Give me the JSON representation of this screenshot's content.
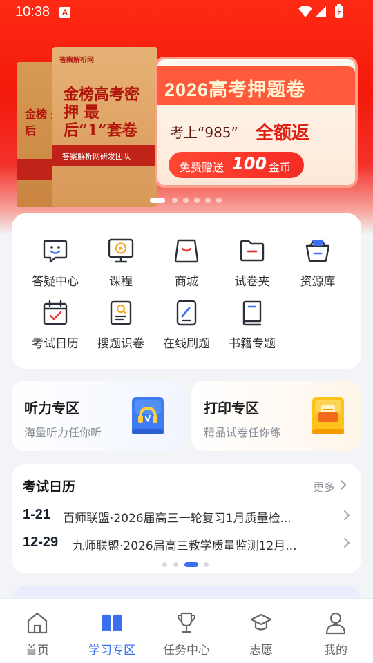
{
  "status_bar": {
    "time": "10:38",
    "notification_badge": "A"
  },
  "banner": {
    "book_label": "答案解析网",
    "book_title": "金榜高考密押 最后“1”套卷",
    "book_back_title": "金榜 最后",
    "book_stripe": "答案解析网研发团队",
    "title": "2026高考押题卷",
    "subtitle": "考上“985”",
    "subtitle_strong": "全额返",
    "pill_prefix": "免费赠送",
    "pill_amount": "100",
    "pill_suffix": "金币",
    "dot_count": 6,
    "active_dot": 0
  },
  "grid": {
    "items": [
      {
        "label": "答疑中心",
        "icon": "chat-bubble-icon"
      },
      {
        "label": "课程",
        "icon": "monitor-play-icon"
      },
      {
        "label": "商城",
        "icon": "shopping-bag-icon"
      },
      {
        "label": "试卷夹",
        "icon": "folder-icon"
      },
      {
        "label": "资源库",
        "icon": "basket-icon"
      },
      {
        "label": "考试日历",
        "icon": "calendar-check-icon"
      },
      {
        "label": "搜题识卷",
        "icon": "document-search-icon"
      },
      {
        "label": "在线刷题",
        "icon": "tablet-pen-icon"
      },
      {
        "label": "书籍专题",
        "icon": "book-icon"
      }
    ]
  },
  "zones": [
    {
      "title": "听力专区",
      "subtitle": "海量听力任你听",
      "icon": "headphones-icon"
    },
    {
      "title": "打印专区",
      "subtitle": "精品试卷任你练",
      "icon": "printer-icon"
    }
  ],
  "exam_calendar": {
    "title": "考试日历",
    "more_label": "更多",
    "rows": [
      {
        "date": "1-21",
        "text": "百师联盟·2026届高三一轮复习1月质量检..."
      },
      {
        "date": "12-29",
        "text": "九师联盟·2026届高三教学质量监测12月..."
      }
    ],
    "dot_count": 4,
    "active_dot": 2
  },
  "bottom_nav": {
    "items": [
      {
        "label": "首页",
        "icon": "home-icon"
      },
      {
        "label": "学习专区",
        "icon": "open-book-icon"
      },
      {
        "label": "任务中心",
        "icon": "trophy-icon"
      },
      {
        "label": "志愿",
        "icon": "graduation-cap-icon"
      },
      {
        "label": "我的",
        "icon": "person-icon"
      }
    ],
    "active_index": 1
  },
  "colors": {
    "primary": "#3a6ff0",
    "banner_red": "#f21a0c",
    "icon_red": "#e8382e",
    "icon_stroke": "#2b2f38"
  }
}
